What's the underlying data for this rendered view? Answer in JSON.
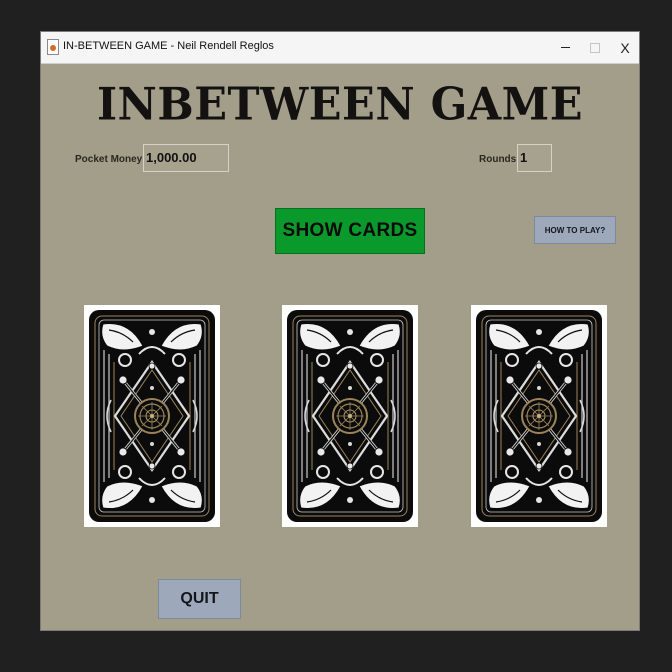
{
  "window": {
    "title": "IN-BETWEEN GAME - Neil Rendell Reglos",
    "controls": {
      "minimize_icon": "minimize-icon",
      "maximize_icon": "maximize-icon",
      "close_label": "X"
    }
  },
  "game": {
    "heading": "INBETWEEN GAME",
    "pocket_money": {
      "label": "Pocket Money:",
      "value": "1,000.00"
    },
    "rounds": {
      "label": "Rounds:",
      "value": "1"
    },
    "buttons": {
      "show_cards": "SHOW CARDS",
      "how_to_play": "HOW TO PLAY?",
      "quit": "QUIT"
    },
    "cards": [
      {
        "face": "card-back"
      },
      {
        "face": "card-back"
      },
      {
        "face": "card-back"
      }
    ]
  },
  "colors": {
    "background": "#a29e8a",
    "show_cards_button": "#0a9a2c",
    "secondary_buttons": "#9da9bb",
    "card_back": "#0b0b0b",
    "card_ornament": "#e8e8e8",
    "card_gold": "#9c8459"
  }
}
